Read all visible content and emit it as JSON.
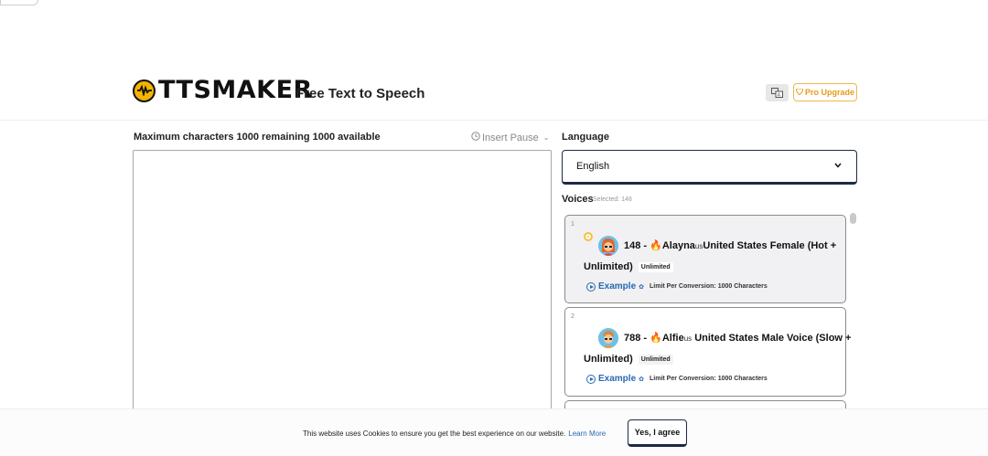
{
  "header": {
    "logo_text": "TTSMAKER",
    "tagline": "Free Text to Speech",
    "pro_upgrade_label": "Pro Upgrade"
  },
  "editor": {
    "max_chars_text": "Maximum characters 1000 remaining 1000 available",
    "insert_pause_label": "Insert Pause",
    "text_value": ""
  },
  "language": {
    "label": "Language",
    "selected": "English"
  },
  "voices": {
    "label": "Voices",
    "selected_text": "Selected: 148",
    "items": [
      {
        "index": "1",
        "title_prefix": "148 - ",
        "name": "Alayna",
        "locale": "us",
        "title_suffix": "United States Female (Hot +",
        "title_line2": "Unlimited)",
        "badge": "Unlimited",
        "example_label": "Example",
        "limit_text": "Limit Per Conversion: 1000 Characters"
      },
      {
        "index": "2",
        "title_prefix": "788 - ",
        "name": "Alfie",
        "locale": "us",
        "title_suffix": " United States Male Voice (Slow +",
        "title_line2": "Unlimited)",
        "badge": "Unlimited",
        "example_label": "Example",
        "limit_text": "Limit Per Conversion: 1000 Characters"
      }
    ]
  },
  "cookie": {
    "text": "This website uses Cookies to ensure you get the best experience on our website.",
    "learn_more": "Learn More",
    "agree_label": "Yes, I agree"
  },
  "colors": {
    "accent_blue": "#2869b3",
    "brand_yellow": "#f4b400",
    "pro_orange": "#e59b17",
    "dark_border": "#1d2a44"
  }
}
